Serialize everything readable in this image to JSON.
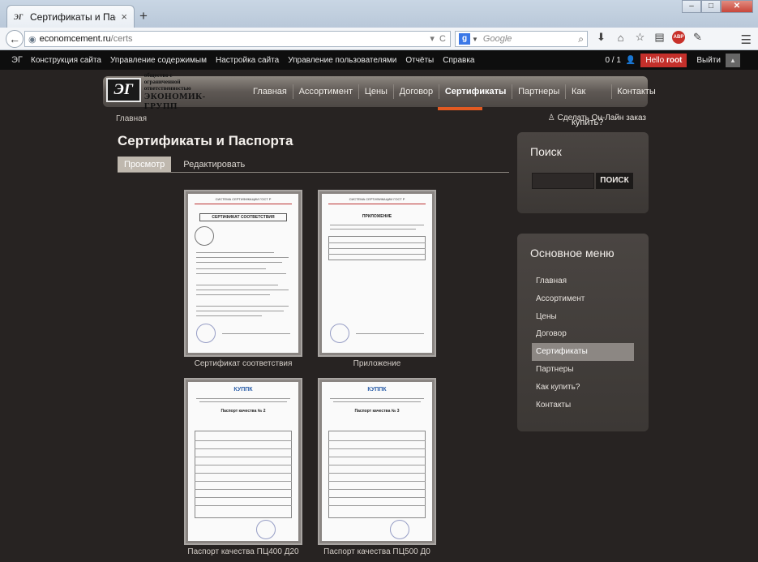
{
  "browser": {
    "tab_title": "Сертификаты и Паспорта...",
    "tab_favicon": "ЭГ",
    "new_tab": "+",
    "url_host": "economcement.ru",
    "url_path": "/certs",
    "search_engine": "g-logo",
    "search_placeholder": "Google"
  },
  "admin_bar": {
    "links": [
      "Конструкция сайта",
      "Управление содержимым",
      "Настройка сайта",
      "Управление пользователями",
      "Отчёты",
      "Справка"
    ],
    "count": "0 / 1",
    "hello": "Hello",
    "user": "root",
    "logout": "Выйти"
  },
  "header": {
    "logo_mark": "ЭГ",
    "logo_sub": "общество с ограниченной ответственностью",
    "logo_name": "ЭКОНОМИК-ГРУПП",
    "nav": [
      "Главная",
      "Ассортимент",
      "Цены",
      "Договор",
      "Сертификаты",
      "Партнеры",
      "Как купить?",
      "Контакты"
    ],
    "active": "Сертификаты"
  },
  "breadcrumb": "Главная",
  "order_link": "Сделать Он-Лайн заказ",
  "page_title": "Сертификаты и Паспорта",
  "tabs": {
    "view": "Просмотр",
    "edit": "Редактировать"
  },
  "certificates": [
    {
      "caption": "Сертификат соответствия",
      "head": "СИСТЕМА СЕРТИФИКАЦИИ ГОСТ Р",
      "title": "СЕРТИФИКАТ СООТВЕТСТВИЯ"
    },
    {
      "caption": "Приложение",
      "head": "СИСТЕМА СЕРТИФИКАЦИИ ГОСТ Р",
      "title": "ПРИЛОЖЕНИЕ"
    },
    {
      "caption": "Паспорт качества ПЦ400 Д20",
      "logo": "КУППК",
      "title": "Паспорт качества № 2"
    },
    {
      "caption": "Паспорт качества ПЦ500 Д0",
      "logo": "КУППК",
      "title": "Паспорт качества № 3"
    }
  ],
  "search_panel": {
    "title": "Поиск",
    "button": "ПОИСК"
  },
  "menu_panel": {
    "title": "Основное меню",
    "items": [
      "Главная",
      "Ассортимент",
      "Цены",
      "Договор",
      "Сертификаты",
      "Партнеры",
      "Как купить?",
      "Контакты"
    ],
    "active": "Сертификаты"
  },
  "colors": {
    "accent": "#e25a22",
    "admin_red": "#c4302b",
    "site_bg": "#272322"
  }
}
